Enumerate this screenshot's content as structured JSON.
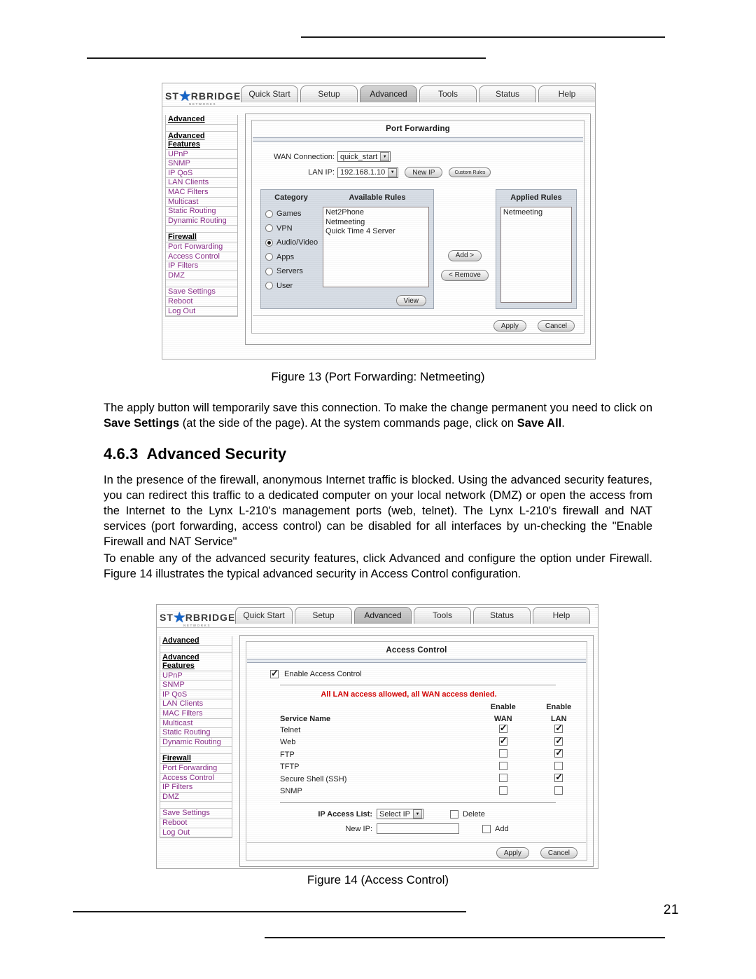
{
  "page": {
    "number": "21"
  },
  "figure13": {
    "caption": "Figure 13 (Port Forwarding: Netmeeting)",
    "logo": {
      "left_text": "ST",
      "star": "★",
      "right_text": "RBRIDGE",
      "subtitle": "NETWORKS"
    },
    "tabs": [
      {
        "label": "Quick Start",
        "active": false
      },
      {
        "label": "Setup",
        "active": false
      },
      {
        "label": "Advanced",
        "active": true
      },
      {
        "label": "Tools",
        "active": false
      },
      {
        "label": "Status",
        "active": false
      },
      {
        "label": "Help",
        "active": false
      }
    ],
    "sidebar": {
      "title": "Advanced",
      "group1_title_line1": "Advanced",
      "group1_title_line2": "Features",
      "group1_items": [
        "UPnP",
        "SNMP",
        "IP QoS",
        "LAN Clients",
        "MAC Filters",
        "Multicast",
        "Static Routing",
        "Dynamic Routing"
      ],
      "group2_title": "Firewall",
      "group2_items": [
        "Port Forwarding",
        "Access Control",
        "IP Filters",
        "DMZ"
      ],
      "group3_items": [
        "Save Settings",
        "Reboot",
        "Log Out"
      ]
    },
    "panel": {
      "title": "Port Forwarding",
      "wan_label": "WAN Connection:",
      "wan_value": "quick_start",
      "lan_label": "LAN IP:",
      "lan_value": "192.168.1.10",
      "new_ip_button": "New IP",
      "custom_rules_button": "Custom Rules",
      "category_header": "Category",
      "available_header": "Available Rules",
      "applied_header": "Applied Rules",
      "categories": [
        {
          "label": "Games",
          "selected": false
        },
        {
          "label": "VPN",
          "selected": false
        },
        {
          "label": "Audio/Video",
          "selected": true
        },
        {
          "label": "Apps",
          "selected": false
        },
        {
          "label": "Servers",
          "selected": false
        },
        {
          "label": "User",
          "selected": false
        }
      ],
      "available_rules": [
        "Net2Phone",
        "Netmeeting",
        "Quick Time 4 Server"
      ],
      "applied_rules": [
        "Netmeeting"
      ],
      "add_button": "Add >",
      "remove_button": "< Remove",
      "view_button": "View",
      "apply_button": "Apply",
      "cancel_button": "Cancel"
    }
  },
  "text": {
    "para1_part1": "The apply button will temporarily save this connection. To make the change permanent you need to click on ",
    "para1_bold1": "Save Settings",
    "para1_part2": " (at the side of the page).  At the system commands page, click on ",
    "para1_bold2": "Save All",
    "para1_part3": ".",
    "heading_number": "4.6.3",
    "heading_title": "Advanced Security",
    "para2": "In the presence of the firewall, anonymous Internet traffic is blocked. Using the advanced security features, you can redirect this traffic to a dedicated computer on your local network (DMZ) or open the access from the Internet to the Lynx L-210's management ports (web, telnet).  The Lynx L-210's firewall and NAT services (port forwarding, access control) can be disabled for all interfaces by un-checking the \"Enable Firewall and NAT Service\"",
    "para3": "To enable any of the advanced security features, click Advanced and configure the option under Firewall.  Figure 14 illustrates the typical advanced security in Access Control configuration."
  },
  "figure14": {
    "caption": "Figure 14 (Access Control)",
    "logo": {
      "left_text": "ST",
      "star": "★",
      "right_text": "RBRIDGE",
      "subtitle": "NETWORKS"
    },
    "tabs": [
      {
        "label": "Quick Start",
        "active": false
      },
      {
        "label": "Setup",
        "active": false
      },
      {
        "label": "Advanced",
        "active": true
      },
      {
        "label": "Tools",
        "active": false
      },
      {
        "label": "Status",
        "active": false
      },
      {
        "label": "Help",
        "active": false
      }
    ],
    "sidebar": {
      "title": "Advanced",
      "group1_title_line1": "Advanced",
      "group1_title_line2": "Features",
      "group1_items": [
        "UPnP",
        "SNMP",
        "IP QoS",
        "LAN Clients",
        "MAC Filters",
        "Multicast",
        "Static Routing",
        "Dynamic Routing"
      ],
      "group2_title": "Firewall",
      "group2_items": [
        "Port Forwarding",
        "Access Control",
        "IP Filters",
        "DMZ"
      ],
      "group3_items": [
        "Save Settings",
        "Reboot",
        "Log Out"
      ]
    },
    "panel": {
      "title": "Access Control",
      "enable_label": "Enable Access Control",
      "enable_checked": true,
      "warning": "All LAN access allowed, all WAN access denied.",
      "col_service": "Service Name",
      "col_wan_top": "Enable",
      "col_wan_bot": "WAN",
      "col_lan_top": "Enable",
      "col_lan_bot": "LAN",
      "services": [
        {
          "name": "Telnet",
          "wan": true,
          "lan": true
        },
        {
          "name": "Web",
          "wan": true,
          "lan": true
        },
        {
          "name": "FTP",
          "wan": false,
          "lan": true
        },
        {
          "name": "TFTP",
          "wan": false,
          "lan": false
        },
        {
          "name": "Secure Shell (SSH)",
          "wan": false,
          "lan": true
        },
        {
          "name": "SNMP",
          "wan": false,
          "lan": false
        }
      ],
      "ip_access_label": "IP Access List:",
      "ip_access_value": "Select IP",
      "delete_label": "Delete",
      "delete_checked": false,
      "new_ip_label": "New IP:",
      "new_ip_value": "",
      "add_label": "Add",
      "add_checked": false,
      "apply_button": "Apply",
      "cancel_button": "Cancel"
    }
  },
  "colors": {
    "sidebar_link": "#8a2f8a",
    "warning_red": "#d30000",
    "star_blue": "#1565c8",
    "panel_blue_gray": "#d7dde5"
  }
}
